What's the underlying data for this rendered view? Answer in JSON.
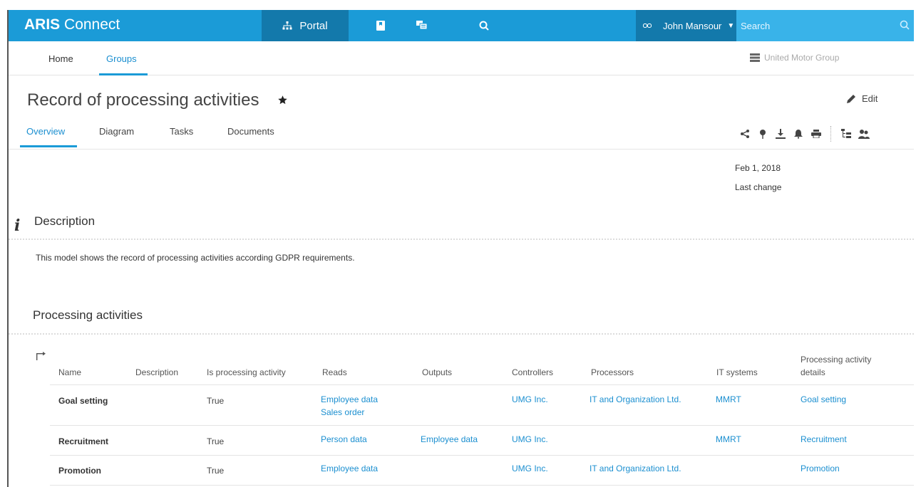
{
  "app": {
    "brand_bold": "ARIS",
    "brand_rest": " Connect"
  },
  "topbar": {
    "portal_label": "Portal",
    "icons": [
      "sitemap-icon",
      "bookmark-icon",
      "collaboration-icon",
      "search-icon"
    ],
    "user_name": "John Mansour",
    "search_placeholder": "Search"
  },
  "subnav": {
    "home": "Home",
    "groups": "Groups",
    "organization": "United Motor Group"
  },
  "page": {
    "title": "Record of processing activities",
    "edit_label": "Edit",
    "tabs": [
      "Overview",
      "Diagram",
      "Tasks",
      "Documents"
    ],
    "active_tab": "Overview",
    "toolbar_icons": [
      "share-icon",
      "pin-icon",
      "download-icon",
      "subscribe-icon",
      "print-icon",
      "tree-icon",
      "users-icon"
    ],
    "last_change_date": "Feb 1, 2018",
    "last_change_label": "Last change"
  },
  "description": {
    "heading": "Description",
    "text": "This model shows the record of processing activities according GDPR requirements."
  },
  "processing": {
    "heading": "Processing activities",
    "columns": [
      "Name",
      "Description",
      "Is processing activity",
      "Reads",
      "Outputs",
      "Controllers",
      "Processors",
      "IT systems",
      "Processing activity details"
    ],
    "rows": [
      {
        "name": "Goal setting",
        "description": "",
        "is_processing": "True",
        "reads": [
          "Employee data",
          "Sales order"
        ],
        "outputs": "",
        "controllers": "UMG Inc.",
        "processors": "IT and Organization Ltd.",
        "it_systems": "MMRT",
        "details": "Goal setting"
      },
      {
        "name": "Recruitment",
        "description": "",
        "is_processing": "True",
        "reads": [
          "Person data"
        ],
        "outputs": "Employee data",
        "controllers": "UMG Inc.",
        "processors": "",
        "it_systems": "MMRT",
        "details": "Recruitment"
      },
      {
        "name": "Promotion",
        "description": "",
        "is_processing": "True",
        "reads": [
          "Employee data"
        ],
        "outputs": "",
        "controllers": "UMG Inc.",
        "processors": "IT and Organization Ltd.",
        "it_systems": "",
        "details": "Promotion"
      }
    ]
  },
  "colors": {
    "accent": "#1b9bd7",
    "accent_dark": "#1379ab",
    "link": "#1b8fd0"
  }
}
